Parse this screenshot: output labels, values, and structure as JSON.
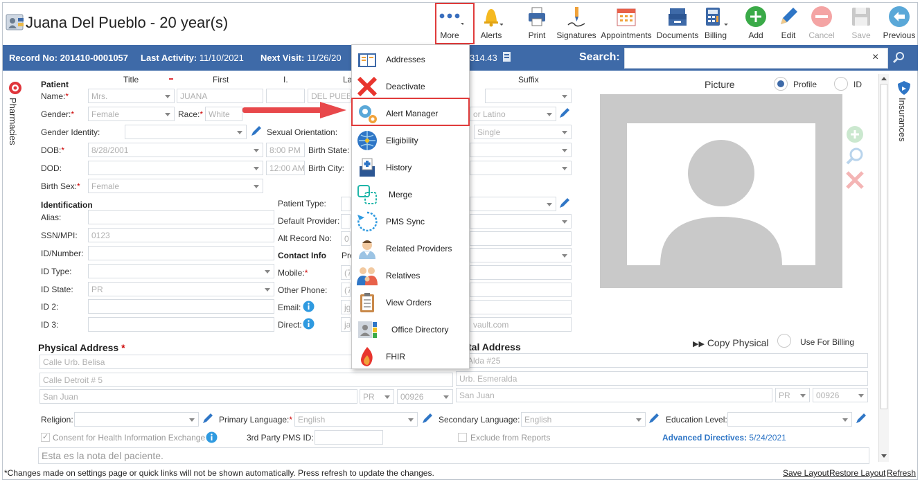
{
  "window": {
    "title": "Juana Del Pueblo - 20 year(s)"
  },
  "toolbar": [
    {
      "label": "More",
      "icon": "more-dots-icon"
    },
    {
      "label": "Alerts",
      "icon": "bell-icon"
    },
    {
      "label": "Print",
      "icon": "printer-icon"
    },
    {
      "label": "Signatures",
      "icon": "signature-pen-icon"
    },
    {
      "label": "Appointments",
      "icon": "calendar-icon"
    },
    {
      "label": "Documents",
      "icon": "documents-tray-icon"
    },
    {
      "label": "Billing",
      "icon": "calculator-icon"
    },
    {
      "label": "Add",
      "icon": "add-circle-icon"
    },
    {
      "label": "Edit",
      "icon": "pencil-icon"
    },
    {
      "label": "Cancel",
      "icon": "cancel-circle-icon"
    },
    {
      "label": "Save",
      "icon": "floppy-disk-icon"
    },
    {
      "label": "Previous",
      "icon": "back-arrow-icon"
    }
  ],
  "infobar": {
    "record_label": "Record No:",
    "record_value": "201410-0001057",
    "activity_label": "Last Activity:",
    "activity_value": "11/10/2021",
    "visit_label": "Next Visit:",
    "visit_value": "11/26/20",
    "balance_partial": "314.43",
    "search_label": "Search:",
    "close_glyph": "×"
  },
  "side": {
    "left": "Pharmacies",
    "right": "Insurances"
  },
  "patient": {
    "section": "Patient",
    "col_title": "Title",
    "col_first": "First",
    "col_middle": "I.",
    "col_last": "La",
    "col_suffix": "Suffix",
    "name_label": "Name:",
    "title_value": "Mrs.",
    "first_value": "JUANA",
    "last_value": "DEL PUEBLO",
    "gender_label": "Gender:",
    "gender_value": "Female",
    "race_label": "Race:",
    "race_value": "White",
    "ethnicity_partial": "or Latino",
    "gender_identity_label": "Gender Identity:",
    "sexual_orientation_label": "Sexual Orientation:",
    "marital_value": "Single",
    "dob_label": "DOB:",
    "dob_value": "8/28/2001",
    "dob_time": "8:00 PM",
    "birth_state_label": "Birth State:",
    "dod_label": "DOD:",
    "dod_time": "12:00 AM",
    "birth_city_label": "Birth City:",
    "birth_sex_label": "Birth Sex:",
    "birth_sex_value": "Female"
  },
  "identification": {
    "section": "Identification",
    "alias_label": "Alias:",
    "ssn_label": "SSN/MPI:",
    "ssn_value": "0123",
    "idnum_label": "ID/Number:",
    "idtype_label": "ID Type:",
    "idstate_label": "ID State:",
    "idstate_value": "PR",
    "id2_label": "ID 2:",
    "id3_label": "ID 3:"
  },
  "mid": {
    "patient_type_label": "Patient Type:",
    "default_provider_label": "Default Provider:",
    "alt_record_label": "Alt Record No:",
    "alt_record_partial": "0",
    "contact_section": "Contact Info",
    "contact_partial": "Pre",
    "mobile_label": "Mobile:",
    "mobile_partial": "(7",
    "other_phone_label": "Other Phone:",
    "other_phone_partial": "(7",
    "email_label": "Email:",
    "email_partial": "jg",
    "direct_label": "Direct:",
    "direct_partial": "ja",
    "direct_suffix": "vault.com"
  },
  "picture": {
    "label": "Picture",
    "opt_profile": "Profile",
    "opt_id": "ID"
  },
  "physical": {
    "section": "Physical Address",
    "line1": "Calle Urb. Belisa",
    "line2": "Calle Detroit # 5",
    "city": "San Juan",
    "state": "PR",
    "zip": "00926"
  },
  "postal": {
    "section_partial": "tal Address",
    "copy_label": "Copy Physical",
    "use_billing": "Use For Billing",
    "line1": "le Alda #25",
    "line2": "Urb. Esmeralda",
    "city": "San Juan",
    "state": "PR",
    "zip": "00926"
  },
  "bottom": {
    "religion_label": "Religion:",
    "primary_lang_label": "Primary Language:",
    "primary_lang_value": "English",
    "secondary_lang_label": "Secondary Language:",
    "secondary_lang_value": "English",
    "education_label": "Education Level:",
    "consent_label": "Consent for Health Information Exchange",
    "third_party_label": "3rd Party PMS ID:",
    "exclude_label": "Exclude from Reports",
    "advanced_label": "Advanced Directives:",
    "advanced_value": "5/24/2021",
    "note": "Esta es la nota del paciente."
  },
  "menu": [
    {
      "label": "Addresses",
      "icon": "address-book-icon"
    },
    {
      "label": "Deactivate",
      "icon": "red-x-icon"
    },
    {
      "label": "Alert Manager",
      "icon": "gears-icon"
    },
    {
      "label": "Eligibility",
      "icon": "globe-network-icon"
    },
    {
      "label": "History",
      "icon": "medical-history-icon"
    },
    {
      "label": "Merge",
      "icon": "merge-icon"
    },
    {
      "label": "PMS Sync",
      "icon": "sync-icon"
    },
    {
      "label": "Related Providers",
      "icon": "doctor-icon"
    },
    {
      "label": "Relatives",
      "icon": "family-icon"
    },
    {
      "label": "View Orders",
      "icon": "clipboard-icon"
    },
    {
      "label": "Office Directory",
      "icon": "directory-icon"
    },
    {
      "label": "FHIR",
      "icon": "fhir-flame-icon"
    }
  ],
  "footer": {
    "note": "*Changes made on settings page or quick links will not be shown automatically. Press refresh to update the changes.",
    "save_layout": "Save Layout",
    "restore_layout": "Restore Layout",
    "refresh": "Refresh"
  },
  "colors": {
    "bar": "#3e6aa8",
    "accent": "#e03b3b",
    "blue": "#2f76c6",
    "green": "#3aaa48"
  }
}
